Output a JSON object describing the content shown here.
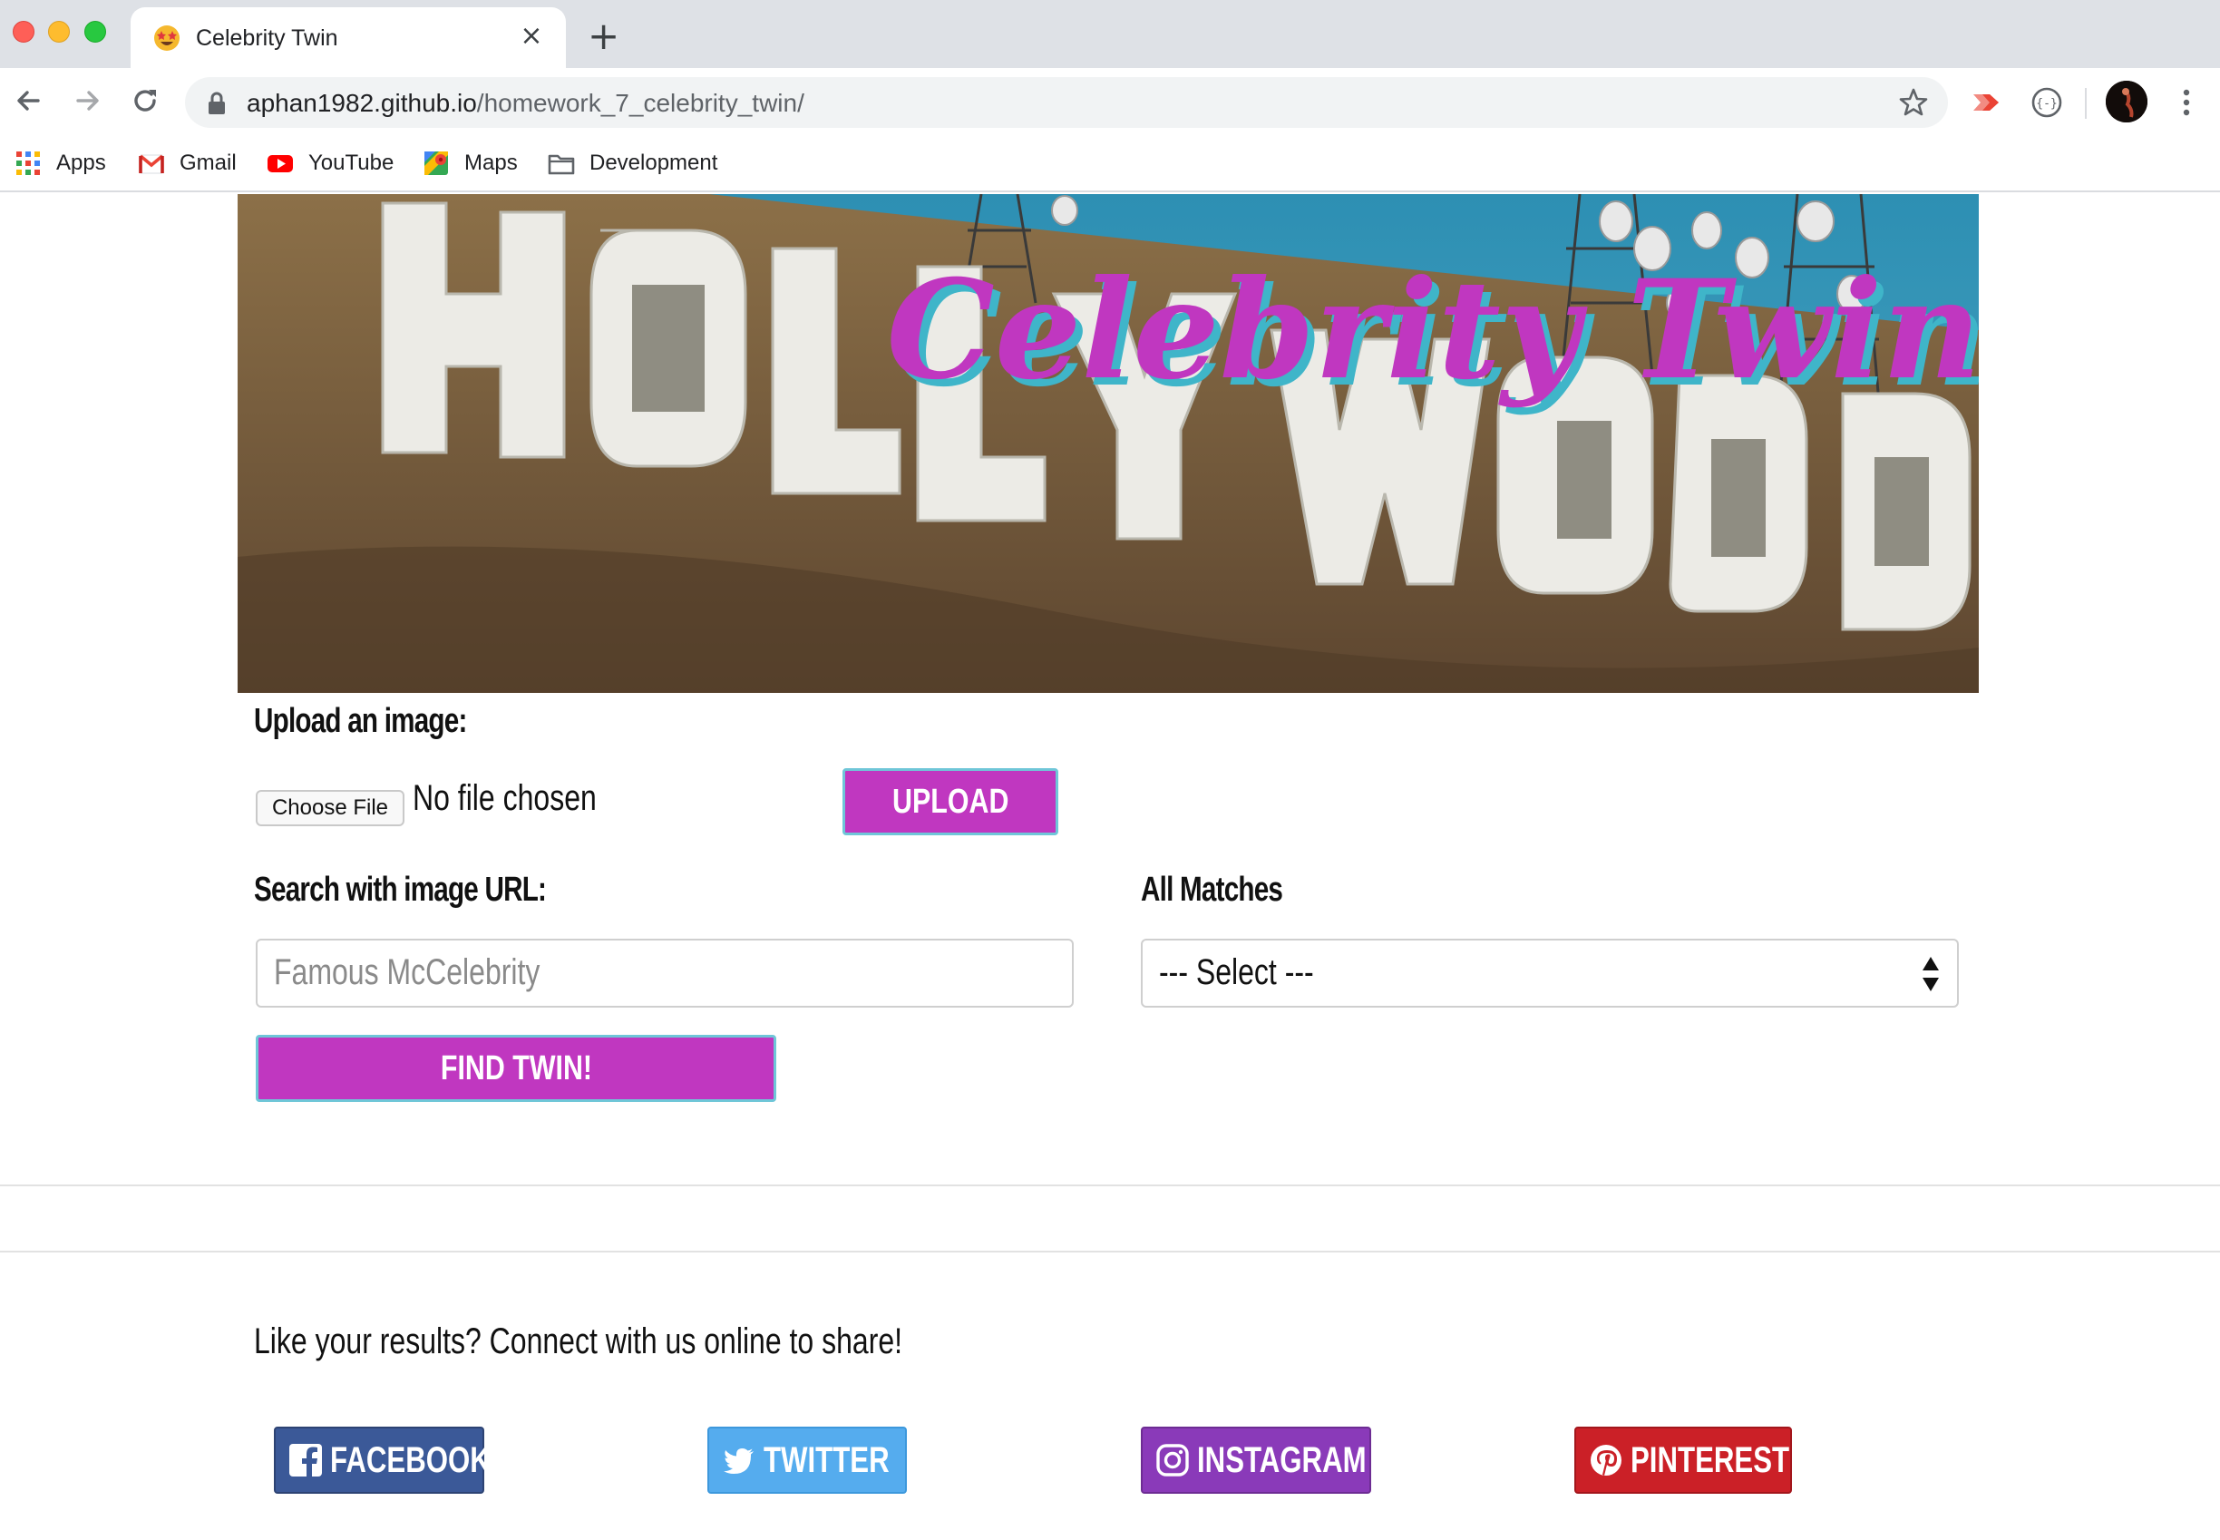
{
  "browser": {
    "tab_title": "Celebrity Twin",
    "tab_favicon": "star-struck-emoji-icon",
    "url_host": "aphan1982.github.io",
    "url_path": "/homework_7_celebrity_twin/",
    "bookmarks": [
      {
        "label": "Apps",
        "icon": "apps-grid-icon"
      },
      {
        "label": "Gmail",
        "icon": "gmail-icon"
      },
      {
        "label": "YouTube",
        "icon": "youtube-icon"
      },
      {
        "label": "Maps",
        "icon": "maps-icon"
      },
      {
        "label": "Development",
        "icon": "folder-icon"
      }
    ]
  },
  "hero": {
    "sign_text": "HOLLYWOOD",
    "title": "Celebrity Twin!"
  },
  "upload": {
    "heading": "Upload an image:",
    "choose_file_label": "Choose File",
    "file_status": "No file chosen",
    "upload_button": "UPLOAD"
  },
  "search": {
    "heading": "Search with image URL:",
    "placeholder": "Famous McCelebrity",
    "find_button": "FIND TWIN!"
  },
  "matches": {
    "heading": "All Matches",
    "selected": "--- Select ---"
  },
  "footer": {
    "share_text": "Like your results? Connect with us online to share!",
    "social": [
      {
        "label": "FACEBOOK",
        "icon": "facebook-icon",
        "color": "#3b5998"
      },
      {
        "label": "TWITTER",
        "icon": "twitter-icon",
        "color": "#55acee"
      },
      {
        "label": "INSTAGRAM",
        "icon": "instagram-icon",
        "color": "#8a3ab9"
      },
      {
        "label": "PINTEREST",
        "icon": "pinterest-icon",
        "color": "#cb2027"
      }
    ]
  },
  "colors": {
    "accent": "#c037c0",
    "accent_border": "#6fc6d8"
  }
}
